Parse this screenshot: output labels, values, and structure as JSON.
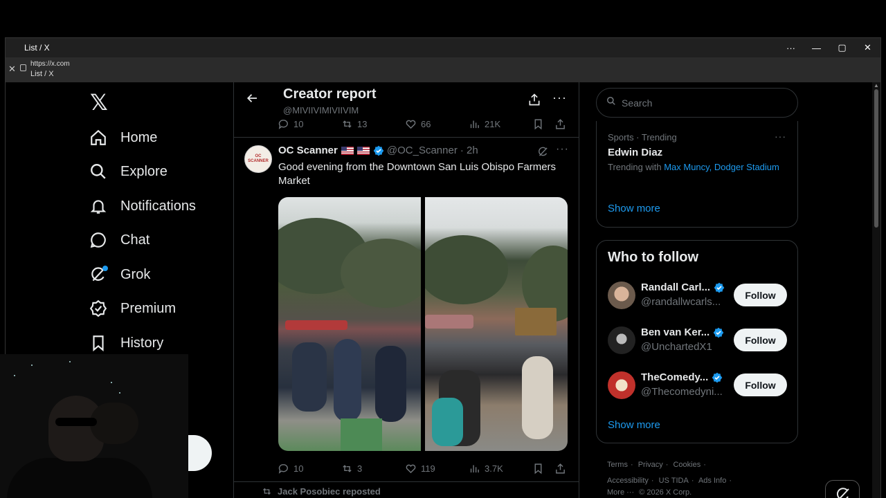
{
  "window": {
    "title": "List / X",
    "url": "https://x.com",
    "page_title": "List / X"
  },
  "nav": {
    "items": [
      {
        "label": "Home",
        "icon": "home-icon"
      },
      {
        "label": "Explore",
        "icon": "search-icon"
      },
      {
        "label": "Notifications",
        "icon": "bell-icon"
      },
      {
        "label": "Chat",
        "icon": "chat-icon"
      },
      {
        "label": "Grok",
        "icon": "grok-icon"
      },
      {
        "label": "Premium",
        "icon": "premium-icon"
      },
      {
        "label": "History",
        "icon": "bookmark-icon"
      }
    ]
  },
  "header": {
    "title": "Creator report",
    "handle": "@MIVIIVIMIVIIVIM"
  },
  "prev_tweet": {
    "replies": "10",
    "reposts": "13",
    "likes": "66",
    "views": "21K"
  },
  "tweet": {
    "avatar_text": "OC SCANNER",
    "name": "OC Scanner",
    "handle": "@OC_Scanner",
    "time": "· 2h",
    "text": "Good evening from the Downtown San Luis Obispo Farmers Market",
    "replies": "10",
    "reposts": "3",
    "likes": "119",
    "views": "3.7K"
  },
  "next_tweet": {
    "repost_label": "Jack Posobiec reposted"
  },
  "search": {
    "placeholder": "Search"
  },
  "trend": {
    "meta": "Sports · Trending",
    "name": "Edwin Diaz",
    "with_prefix": "Trending with",
    "with_links": "Max Muncy, Dodger Stadium",
    "show_more": "Show more"
  },
  "who_to_follow": {
    "title": "Who to follow",
    "accounts": [
      {
        "name": "Randall Carl...",
        "handle": "@randallwcarls...",
        "button": "Follow"
      },
      {
        "name": "Ben van Ker...",
        "handle": "@UnchartedX1",
        "button": "Follow"
      },
      {
        "name": "TheComedy...",
        "handle": "@Thecomedyni...",
        "button": "Follow"
      }
    ],
    "show_more": "Show more"
  },
  "footer": {
    "links": [
      "Terms",
      "Privacy",
      "Cookies",
      "Accessibility",
      "US TIDA",
      "Ads Info",
      "More ···"
    ],
    "copyright": "© 2026 X Corp."
  },
  "colors": {
    "accent": "#1d9bf0",
    "background": "#000000",
    "muted": "#71767b",
    "text": "#e7e9ea"
  }
}
